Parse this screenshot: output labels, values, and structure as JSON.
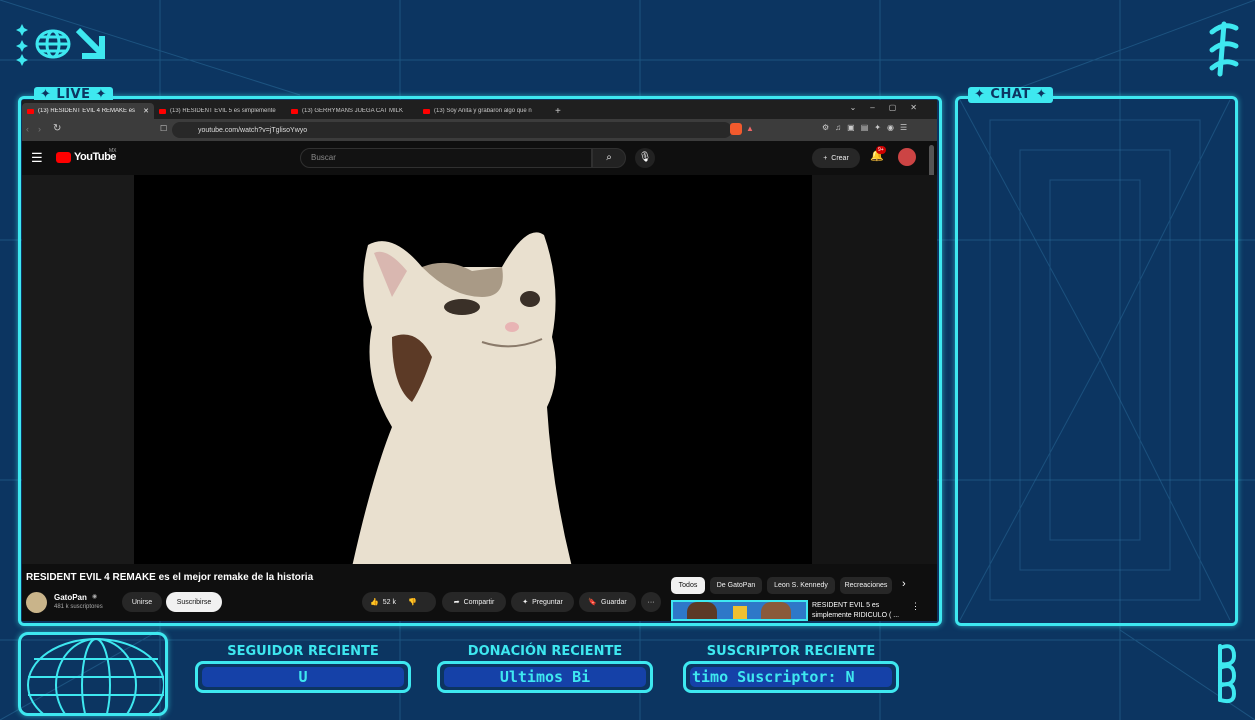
{
  "overlay": {
    "live_tag": "✦ LIVE ✦",
    "chat_tag": "✦ CHAT ✦",
    "recent": [
      {
        "label": "SEGUIDOR RECIENTE",
        "value": "U"
      },
      {
        "label": "DONACIÓN RECIENTE",
        "value": "Ultimos Bi"
      },
      {
        "label": "SUSCRIPTOR RECIENTE",
        "value": "timo Suscriptor: N"
      }
    ],
    "colors": {
      "accent": "#3ee8f0",
      "background": "#0c3561",
      "pill_fill": "#1541a8"
    }
  },
  "browser": {
    "tabs": [
      {
        "title": "(13) RESIDENT EVIL 4 REMAKE es",
        "active": true
      },
      {
        "title": "(13) RESIDENT EVIL 5 es simplemente",
        "active": false
      },
      {
        "title": "(13) GERRYMANS JUEGA CAT MILK",
        "active": false
      },
      {
        "title": "(13) Soy Anita y grabaron algo que n",
        "active": false
      }
    ],
    "url": "youtube.com/watch?v=jTglisoYwyo"
  },
  "youtube": {
    "logo": "YouTube",
    "region": "MX",
    "search_placeholder": "Buscar",
    "create_label": "Crear",
    "notif_count": "9+",
    "video_title": "RESIDENT EVIL 4 REMAKE es el mejor remake de la historia",
    "channel_name": "GatoPan",
    "subscribers": "481 k suscriptores",
    "join_label": "Unirse",
    "subscribe_label": "Suscribirse",
    "likes": "52 k",
    "share_label": "Compartir",
    "ask_label": "Preguntar",
    "save_label": "Guardar",
    "chips": [
      "Todos",
      "De GatoPan",
      "Leon S. Kennedy",
      "Recreaciones"
    ],
    "rec_title_line1": "RESIDENT EVIL 5 es",
    "rec_title_line2": "simplemente RIDICULO ( ..."
  }
}
